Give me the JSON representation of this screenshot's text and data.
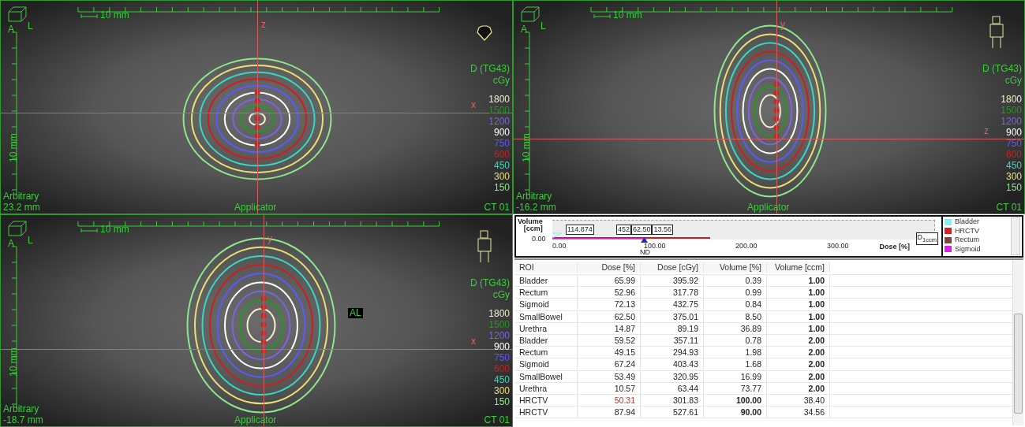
{
  "viewports": [
    {
      "kind": "axial",
      "orientation_letters": [
        "A",
        "L"
      ],
      "scale": "10 mm",
      "vertical_scale": "10 mm",
      "axis_labels": [
        "z",
        "x"
      ],
      "dose_title": "D (TG43)",
      "dose_unit": "cGy",
      "isodose_levels": [
        {
          "label": "1800",
          "color": "#f0f0c8"
        },
        {
          "label": "1500",
          "color": "#1f9a1f"
        },
        {
          "label": "1200",
          "color": "#7a66e0"
        },
        {
          "label": "900",
          "color": "#ffffff"
        },
        {
          "label": "750",
          "color": "#5a5aff"
        },
        {
          "label": "600",
          "color": "#c82020"
        },
        {
          "label": "450",
          "color": "#38d8c0"
        },
        {
          "label": "300",
          "color": "#e8e070"
        },
        {
          "label": "150",
          "color": "#8ce88c"
        }
      ],
      "position_label": "Arbitrary",
      "position_value": "23.2 mm",
      "applicator_label": "Applicator",
      "series_label": "CT 01"
    },
    {
      "kind": "sagittal",
      "orientation_letters": [
        "A",
        "L"
      ],
      "scale": "10 mm",
      "vertical_scale": "10 mm",
      "axis_labels": [
        "y",
        "z"
      ],
      "dose_title": "D (TG43)",
      "dose_unit": "cGy",
      "isodose_levels": [
        {
          "label": "1800",
          "color": "#f0f0c8"
        },
        {
          "label": "1500",
          "color": "#1f9a1f"
        },
        {
          "label": "1200",
          "color": "#7a66e0"
        },
        {
          "label": "900",
          "color": "#ffffff"
        },
        {
          "label": "750",
          "color": "#5a5aff"
        },
        {
          "label": "600",
          "color": "#c82020"
        },
        {
          "label": "450",
          "color": "#38d8c0"
        },
        {
          "label": "300",
          "color": "#e8e070"
        },
        {
          "label": "150",
          "color": "#8ce88c"
        }
      ],
      "position_label": "Arbitrary",
      "position_value": "-16.2 mm",
      "applicator_label": "Applicator",
      "series_label": "CT 01"
    },
    {
      "kind": "coronal",
      "orientation_letters": [
        "A",
        "L"
      ],
      "scale": "10 mm",
      "vertical_scale": "10 mm",
      "axis_labels": [
        "y",
        "x"
      ],
      "structure_labels": [
        "AL"
      ],
      "dose_title": "D (TG43)",
      "dose_unit": "cGy",
      "isodose_levels": [
        {
          "label": "1800",
          "color": "#f0f0c8"
        },
        {
          "label": "1500",
          "color": "#1f9a1f"
        },
        {
          "label": "1200",
          "color": "#7a66e0"
        },
        {
          "label": "900",
          "color": "#ffffff"
        },
        {
          "label": "750",
          "color": "#5a5aff"
        },
        {
          "label": "600",
          "color": "#c82020"
        },
        {
          "label": "450",
          "color": "#38d8c0"
        },
        {
          "label": "300",
          "color": "#e8e070"
        },
        {
          "label": "150",
          "color": "#8ce88c"
        }
      ],
      "position_label": "Arbitrary",
      "position_value": "-18.7 mm",
      "applicator_label": "Applicator",
      "series_label": "CT 01"
    }
  ],
  "dvh": {
    "ylabel": "Volume\n[ccm]",
    "y_tick": "0.00",
    "x_ticks": [
      "0.00",
      "100.00",
      "200.00",
      "300.00"
    ],
    "xlabel": "Dose [%]",
    "marker_label": "ND",
    "value_boxes": [
      "114.874",
      "452",
      "62.50",
      "13.56"
    ],
    "end_box": "D$_{1ccm}$",
    "legend": [
      {
        "name": "Bladder",
        "color": "#86f0f0"
      },
      {
        "name": "HRCTV",
        "color": "#e02020"
      },
      {
        "name": "Rectum",
        "color": "#84443c"
      },
      {
        "name": "Sigmoid",
        "color": "#e020e0"
      }
    ]
  },
  "table": {
    "columns": [
      "ROI",
      "Dose [%]",
      "Dose [cGy]",
      "Volume [%]",
      "Volume [ccm]"
    ],
    "rows": [
      [
        {
          "text": "Bladder",
          "kind": "normal"
        },
        {
          "text": "65.99",
          "kind": "normal"
        },
        {
          "text": "395.92",
          "kind": "normal"
        },
        {
          "text": "0.39",
          "kind": "normal"
        },
        {
          "text": "1.00",
          "kind": "bold"
        }
      ],
      [
        {
          "text": "Rectum",
          "kind": "normal"
        },
        {
          "text": "52.96",
          "kind": "normal"
        },
        {
          "text": "317.78",
          "kind": "normal"
        },
        {
          "text": "0.99",
          "kind": "normal"
        },
        {
          "text": "1.00",
          "kind": "bold"
        }
      ],
      [
        {
          "text": "Sigmoid",
          "kind": "normal"
        },
        {
          "text": "72.13",
          "kind": "normal"
        },
        {
          "text": "432.75",
          "kind": "normal"
        },
        {
          "text": "0.84",
          "kind": "normal"
        },
        {
          "text": "1.00",
          "kind": "bold"
        }
      ],
      [
        {
          "text": "SmallBowel",
          "kind": "normal"
        },
        {
          "text": "62.50",
          "kind": "normal"
        },
        {
          "text": "375.01",
          "kind": "normal"
        },
        {
          "text": "8.50",
          "kind": "normal"
        },
        {
          "text": "1.00",
          "kind": "bold"
        }
      ],
      [
        {
          "text": "Urethra",
          "kind": "normal"
        },
        {
          "text": "14.87",
          "kind": "normal"
        },
        {
          "text": "89.19",
          "kind": "normal"
        },
        {
          "text": "36.89",
          "kind": "normal"
        },
        {
          "text": "1.00",
          "kind": "bold"
        }
      ],
      [
        {
          "text": "Bladder",
          "kind": "normal"
        },
        {
          "text": "59.52",
          "kind": "normal"
        },
        {
          "text": "357.11",
          "kind": "normal"
        },
        {
          "text": "0.78",
          "kind": "normal"
        },
        {
          "text": "2.00",
          "kind": "bold"
        }
      ],
      [
        {
          "text": "Rectum",
          "kind": "normal"
        },
        {
          "text": "49.15",
          "kind": "normal"
        },
        {
          "text": "294.93",
          "kind": "normal"
        },
        {
          "text": "1.98",
          "kind": "normal"
        },
        {
          "text": "2.00",
          "kind": "bold"
        }
      ],
      [
        {
          "text": "Sigmoid",
          "kind": "normal"
        },
        {
          "text": "67.24",
          "kind": "normal"
        },
        {
          "text": "403.43",
          "kind": "normal"
        },
        {
          "text": "1.68",
          "kind": "normal"
        },
        {
          "text": "2.00",
          "kind": "bold"
        }
      ],
      [
        {
          "text": "SmallBowel",
          "kind": "normal"
        },
        {
          "text": "53.49",
          "kind": "normal"
        },
        {
          "text": "320.95",
          "kind": "normal"
        },
        {
          "text": "16.99",
          "kind": "normal"
        },
        {
          "text": "2.00",
          "kind": "bold"
        }
      ],
      [
        {
          "text": "Urethra",
          "kind": "normal"
        },
        {
          "text": "10.57",
          "kind": "normal"
        },
        {
          "text": "63.44",
          "kind": "normal"
        },
        {
          "text": "73.77",
          "kind": "normal"
        },
        {
          "text": "2.00",
          "kind": "bold"
        }
      ],
      [
        {
          "text": "HRCTV",
          "kind": "normal"
        },
        {
          "text": "50.31",
          "kind": "alert"
        },
        {
          "text": "301.83",
          "kind": "normal"
        },
        {
          "text": "100.00",
          "kind": "bold"
        },
        {
          "text": "38.40",
          "kind": "normal"
        }
      ],
      [
        {
          "text": "HRCTV",
          "kind": "normal"
        },
        {
          "text": "87.94",
          "kind": "normal"
        },
        {
          "text": "527.61",
          "kind": "normal"
        },
        {
          "text": "90.00",
          "kind": "bold"
        },
        {
          "text": "34.56",
          "kind": "normal"
        }
      ]
    ]
  }
}
